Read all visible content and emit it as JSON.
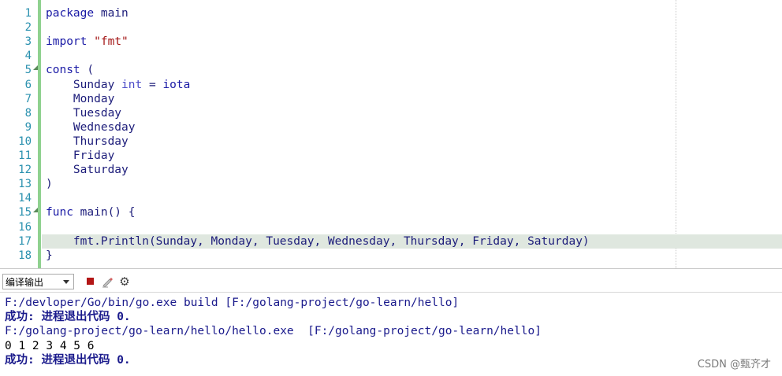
{
  "editor": {
    "current_line_index": 16,
    "lines": [
      {
        "n": "1",
        "fold": false,
        "html": "<span class=\"kw\">package</span> main"
      },
      {
        "n": "2",
        "fold": false,
        "html": ""
      },
      {
        "n": "3",
        "fold": false,
        "html": "<span class=\"kw\">import</span> <span class=\"str\">\"fmt\"</span>"
      },
      {
        "n": "4",
        "fold": false,
        "html": ""
      },
      {
        "n": "5",
        "fold": true,
        "html": "<span class=\"kw\">const</span> ("
      },
      {
        "n": "6",
        "fold": false,
        "html": "    Sunday <span class=\"ty\">int</span> = <span class=\"kw\">iota</span>"
      },
      {
        "n": "7",
        "fold": false,
        "html": "    Monday"
      },
      {
        "n": "8",
        "fold": false,
        "html": "    Tuesday"
      },
      {
        "n": "9",
        "fold": false,
        "html": "    Wednesday"
      },
      {
        "n": "10",
        "fold": false,
        "html": "    Thursday"
      },
      {
        "n": "11",
        "fold": false,
        "html": "    Friday"
      },
      {
        "n": "12",
        "fold": false,
        "html": "    Saturday"
      },
      {
        "n": "13",
        "fold": false,
        "html": ")"
      },
      {
        "n": "14",
        "fold": false,
        "html": ""
      },
      {
        "n": "15",
        "fold": true,
        "html": "<span class=\"kw\">func</span> main() {"
      },
      {
        "n": "16",
        "fold": false,
        "html": ""
      },
      {
        "n": "17",
        "fold": false,
        "html": "    fmt.Println(Sunday, Monday, Tuesday, Wednesday, Thursday, Friday, Saturday)"
      },
      {
        "n": "18",
        "fold": false,
        "html": "}"
      }
    ]
  },
  "toolbar": {
    "output_select": "编译输出",
    "stop_icon": "stop-icon",
    "clear_icon": "clear-output-icon",
    "settings_icon": "gear-icon"
  },
  "output": {
    "lines": [
      {
        "kind": "out-cmd",
        "text": "F:/devloper/Go/bin/go.exe build [F:/golang-project/go-learn/hello]"
      },
      {
        "kind": "out-ok",
        "text": "成功: 进程退出代码 0."
      },
      {
        "kind": "out-cmd",
        "text": "F:/golang-project/go-learn/hello/hello.exe  [F:/golang-project/go-learn/hello]"
      },
      {
        "kind": "out-plain",
        "text": "0 1 2 3 4 5 6"
      },
      {
        "kind": "out-ok",
        "text": "成功: 进程退出代码 0."
      }
    ]
  },
  "watermark": "CSDN @甄齐才"
}
